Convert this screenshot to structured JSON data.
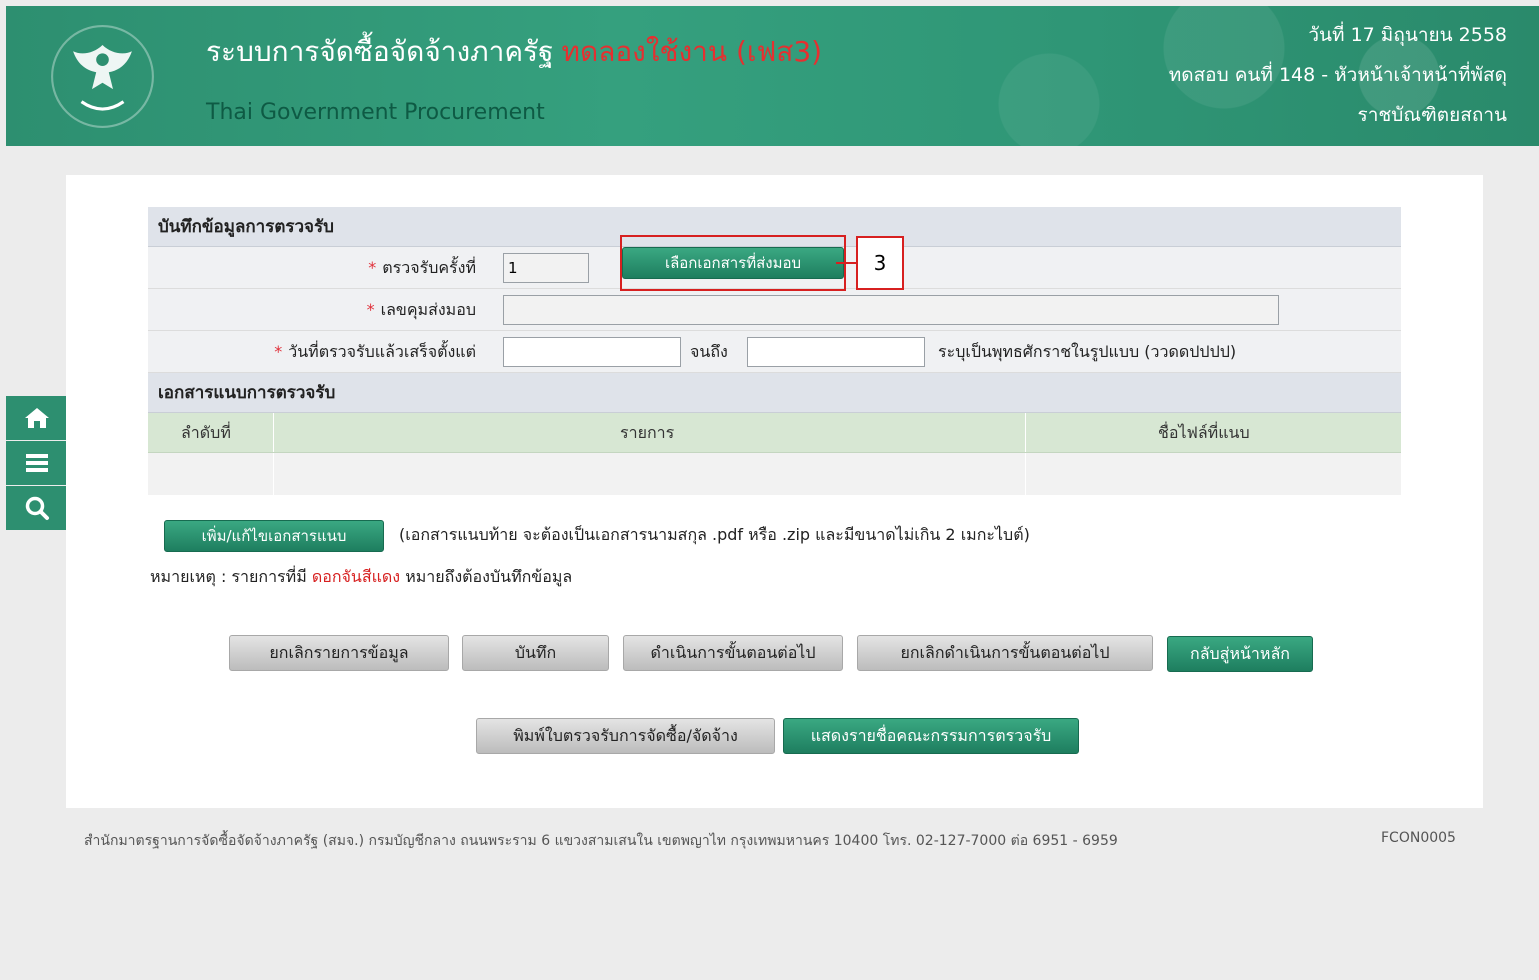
{
  "header": {
    "title": "ระบบการจัดซื้อจัดจ้างภาครัฐ",
    "trial_label": "ทดลองใช้งาน (เฟส3)",
    "subtitle": "Thai Government Procurement",
    "date": "วันที่ 17 มิถุนายน 2558",
    "user": "ทดสอบ คนที่ 148 - หัวหน้าเจ้าหน้าที่พัสดุ",
    "org": "ราชบัณฑิตยสถาน"
  },
  "side_nav": [
    "home-icon",
    "menu-icon",
    "search-icon"
  ],
  "form": {
    "section_title": "บันทึกข้อมูลการตรวจรับ",
    "round_label": "ตรวจรับครั้งที่",
    "round_value": "1",
    "select_doc_button": "เลือกเอกสารที่ส่งมอบ",
    "callout_number": "3",
    "control_no_label": "เลขคุมส่งมอบ",
    "control_no_value": "",
    "date_label": "วันที่ตรวจรับแล้วเสร็จตั้งแต่",
    "date_from": "",
    "to_label": "จนถึง",
    "date_to": "",
    "date_hint": "ระบุเป็นพุทธศักราชในรูปแบบ (ววดดปปปป)"
  },
  "attachments": {
    "section_title": "เอกสารแนบการตรวจรับ",
    "columns": [
      "ลำดับที่",
      "รายการ",
      "ชื่อไฟล์ที่แนบ"
    ],
    "rows": [],
    "edit_button": "เพิ่ม/แก้ไขเอกสารแนบ",
    "edit_note": "(เอกสารแนบท้าย จะต้องเป็นเอกสารนามสกุล .pdf หรือ .zip และมีขนาดไม่เกิน 2 เมกะไบต์)"
  },
  "note": {
    "prefix": "หมายเหตุ : รายการที่มี",
    "highlight": "ดอกจันสีแดง",
    "suffix": "หมายถึงต้องบันทึกข้อมูล"
  },
  "actions": {
    "cancel_item": "ยกเลิกรายการข้อมูล",
    "save": "บันทึก",
    "next_step": "ดำเนินการขั้นตอนต่อไป",
    "cancel_next_step": "ยกเลิกดำเนินการขั้นตอนต่อไป",
    "back_home": "กลับสู่หน้าหลัก",
    "print": "พิมพ์ใบตรวจรับการจัดซื้อ/จัดจ้าง",
    "committee": "แสดงรายชื่อคณะกรรมการตรวจรับ"
  },
  "footer": {
    "text": "สำนักมาตรฐานการจัดซื้อจัดจ้างภาครัฐ (สมจ.) กรมบัญชีกลาง ถนนพระราม 6 แขวงสามเสนใน เขตพญาไท กรุงเทพมหานคร 10400 โทร. 02-127-7000 ต่อ 6951 - 6959",
    "code": "FCON0005"
  },
  "colors": {
    "header_green": "#2d8f70",
    "button_green": "#1e7e5f",
    "required_red": "#e0303a",
    "highlight_red": "#d72020"
  }
}
